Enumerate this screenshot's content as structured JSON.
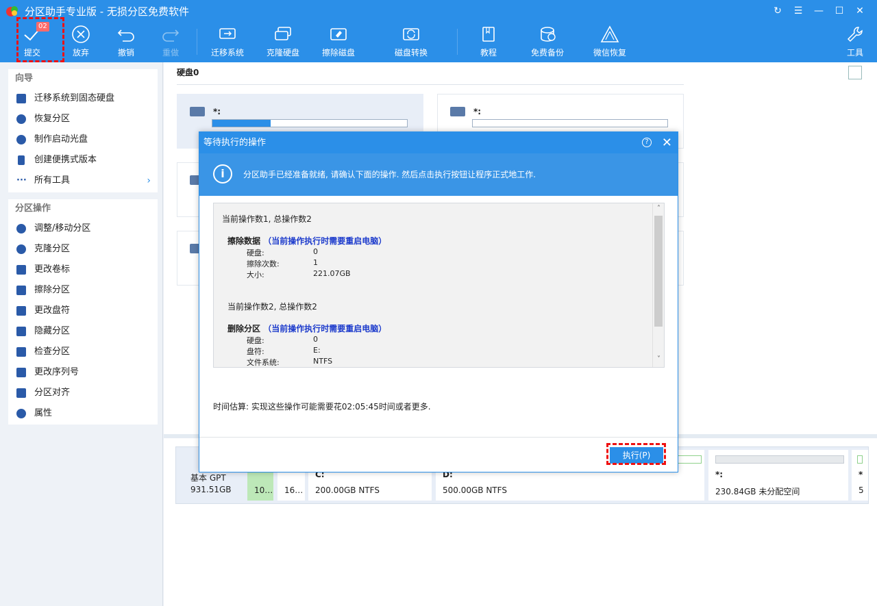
{
  "window": {
    "title": "分区助手专业版 - 无损分区免费软件"
  },
  "toolbar": {
    "submit": "提交",
    "submit_badge": "02",
    "discard": "放弃",
    "undo": "撤销",
    "redo": "重做",
    "migrate": "迁移系统",
    "clone": "克隆硬盘",
    "wipe": "擦除磁盘",
    "convert": "磁盘转换",
    "tutorial": "教程",
    "backup": "免费备份",
    "wechat": "微信恢复",
    "tools": "工具"
  },
  "sidebar": {
    "wizard_title": "向导",
    "wizard_items": [
      "迁移系统到固态硬盘",
      "恢复分区",
      "制作启动光盘",
      "创建便携式版本",
      "所有工具"
    ],
    "ops_title": "分区操作",
    "ops_items": [
      "调整/移动分区",
      "克隆分区",
      "更改卷标",
      "擦除分区",
      "更改盘符",
      "隐藏分区",
      "检查分区",
      "更改序列号",
      "分区对齐",
      "属性"
    ]
  },
  "main": {
    "disk_label": "硬盘0",
    "cards": [
      {
        "label": "*:",
        "fill": 0.3
      },
      {
        "label": "*:",
        "fill": 0
      }
    ]
  },
  "diskmap": {
    "type": "基本 GPT",
    "size": "931.51GB",
    "segments": [
      {
        "name": "",
        "text": "10…"
      },
      {
        "name": "",
        "text": "16…"
      },
      {
        "name": "C:",
        "text": "200.00GB NTFS"
      },
      {
        "name": "D:",
        "text": "500.00GB NTFS"
      },
      {
        "name": "*:",
        "text": "230.84GB 未分配空间"
      },
      {
        "name": "*",
        "text": "5"
      }
    ]
  },
  "dialog": {
    "title": "等待执行的操作",
    "info": "分区助手已经准备就绪, 请确认下面的操作. 然后点击执行按钮让程序正式地工作.",
    "op1": {
      "counter": "当前操作数1, 总操作数2",
      "name": "擦除数据",
      "note": "（当前操作执行时需要重启电脑）",
      "rows": [
        [
          "硬盘:",
          "0"
        ],
        [
          "擦除次数:",
          "1"
        ],
        [
          "大小:",
          "221.07GB"
        ]
      ]
    },
    "op2": {
      "counter": "当前操作数2, 总操作数2",
      "name": "删除分区",
      "note": "（当前操作执行时需要重启电脑）",
      "rows": [
        [
          "硬盘:",
          "0"
        ],
        [
          "盘符:",
          "E:"
        ],
        [
          "文件系统:",
          "NTFS"
        ]
      ]
    },
    "estimate": "时间估算: 实现这些操作可能需要花02:05:45时间或者更多.",
    "execute": "执行(P)"
  },
  "colors": {
    "accent": "#2b8fe8",
    "highlight": "#ee1111",
    "note": "#1e3ccc"
  }
}
